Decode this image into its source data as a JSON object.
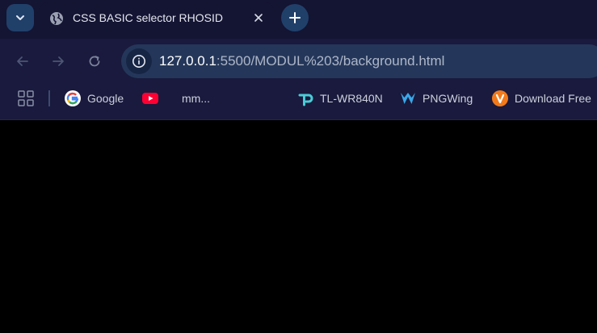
{
  "tab": {
    "title": "CSS BASIC selector RHOSID",
    "favicon": "globe-icon"
  },
  "toolbar": {
    "back": "back-arrow-icon",
    "forward": "forward-arrow-icon",
    "reload": "reload-icon"
  },
  "address": {
    "host": "127.0.0.1",
    "rest": ":5500/MODUL%203/background.html"
  },
  "bookmarks": [
    {
      "label": "Google",
      "icon": "google-icon"
    },
    {
      "label": "",
      "icon": "youtube-icon"
    },
    {
      "label": "mm...",
      "icon": ""
    },
    {
      "label": "TL-WR840N",
      "icon": "tplink-icon"
    },
    {
      "label": "PNGWing",
      "icon": "pngwing-icon"
    },
    {
      "label": "Download Free",
      "icon": "vecteezy-icon"
    }
  ],
  "colors": {
    "page_background": "#000000",
    "chrome_background": "#141433",
    "accent": "#20406a"
  }
}
